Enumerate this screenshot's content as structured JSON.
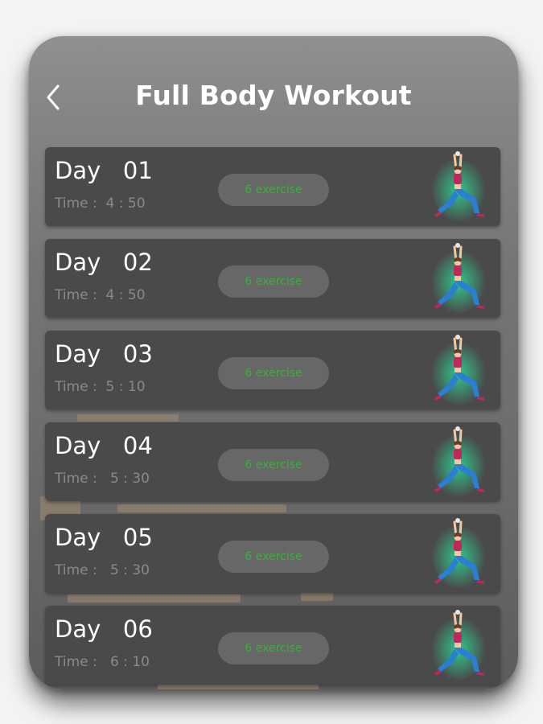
{
  "header": {
    "title": "Full Body Workout"
  },
  "days": [
    {
      "label": "Day   01",
      "time": "Time :  4 : 50",
      "exercise": "6 exercise"
    },
    {
      "label": "Day   02",
      "time": "Time :  4 : 50",
      "exercise": "6 exercise"
    },
    {
      "label": "Day   03",
      "time": "Time :  5 : 10",
      "exercise": "6 exercise"
    },
    {
      "label": "Day   04",
      "time": "Time :   5 : 30",
      "exercise": "6 exercise"
    },
    {
      "label": "Day   05",
      "time": "Time :   5 : 30",
      "exercise": "6 exercise"
    },
    {
      "label": "Day   06",
      "time": "Time :   6 : 10",
      "exercise": "6 exercise"
    }
  ],
  "icons": {
    "back": "chevron-left-icon",
    "figure": "yoga-lunge-figure-icon"
  },
  "colors": {
    "card": "#4a4a4a",
    "pill": "#676767",
    "pill_text": "#2fb82f",
    "glow": "#2ecc8f"
  }
}
